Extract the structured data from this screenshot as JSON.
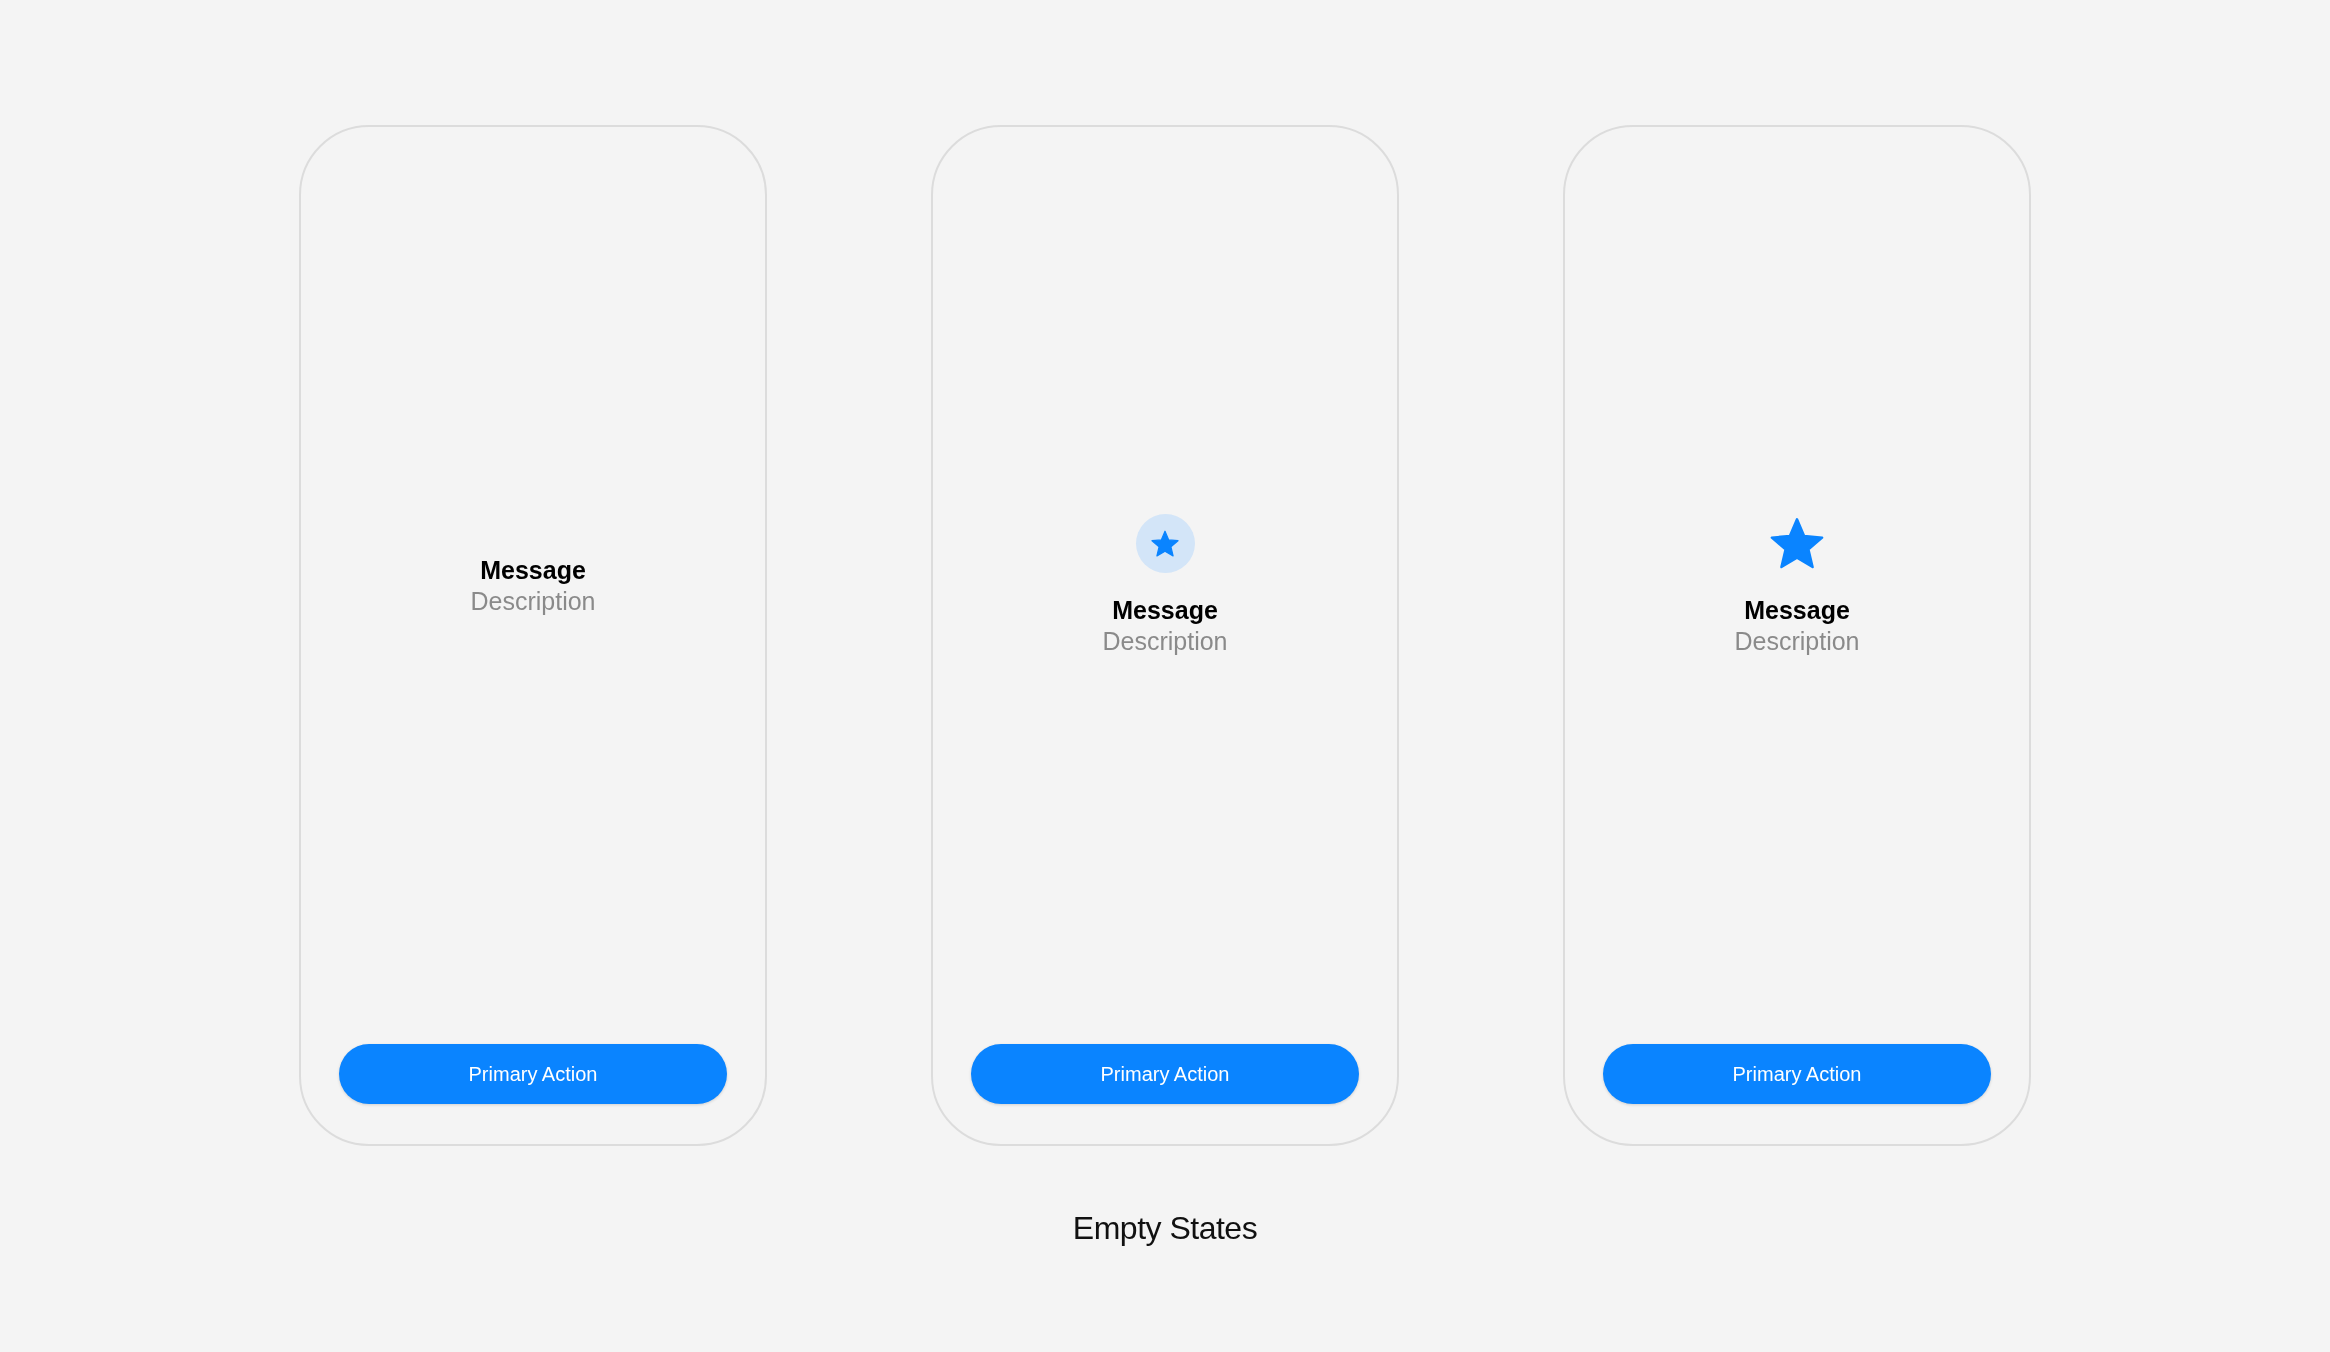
{
  "screens": [
    {
      "kind": "text",
      "message": "Message",
      "description": "Description",
      "button": "Primary Action"
    },
    {
      "kind": "badge",
      "message": "Message",
      "description": "Description",
      "button": "Primary Action"
    },
    {
      "kind": "star",
      "message": "Message",
      "description": "Description",
      "button": "Primary Action"
    }
  ],
  "caption": "Empty States"
}
